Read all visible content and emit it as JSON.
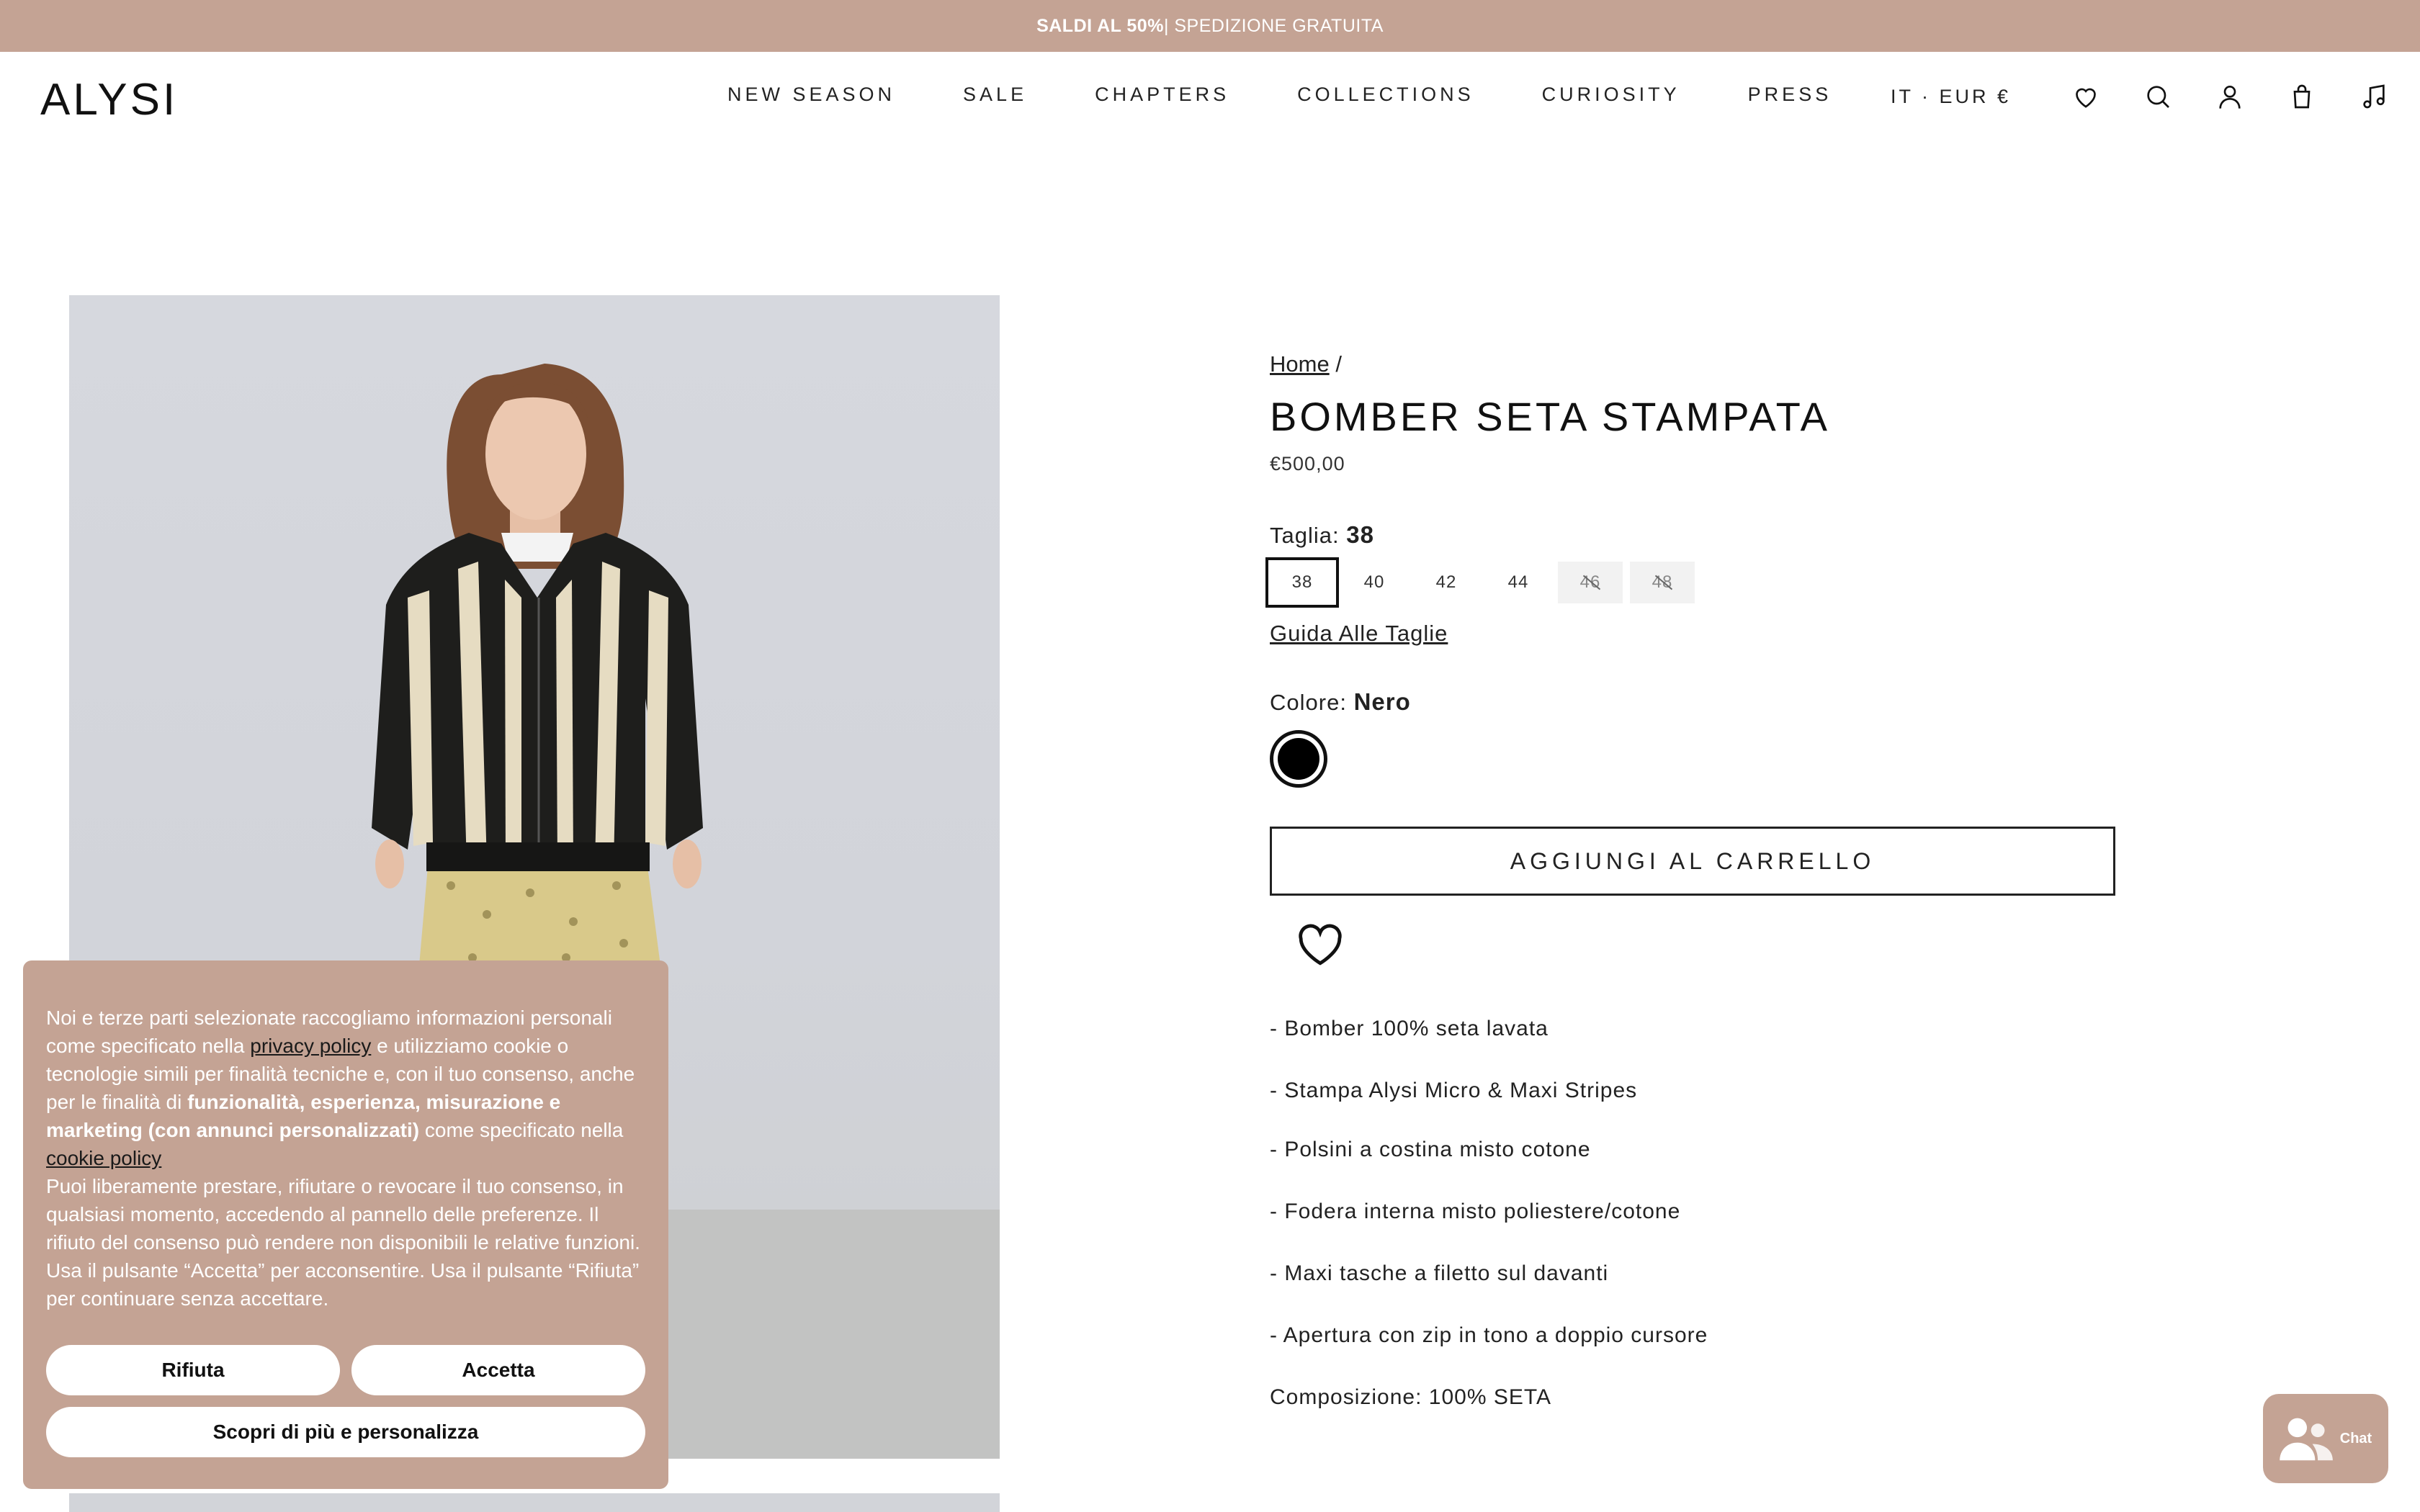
{
  "announcement": {
    "bold": "SALDI AL 50%",
    "rest": "| SPEDIZIONE GRATUITA"
  },
  "header": {
    "logo": "ALYSI",
    "nav": [
      "NEW SEASON",
      "SALE",
      "CHAPTERS",
      "COLLECTIONS",
      "CURIOSITY",
      "PRESS"
    ],
    "locale": "IT · EUR €",
    "icons": [
      "heart-icon",
      "search-icon",
      "user-icon",
      "bag-icon",
      "music-note-icon"
    ]
  },
  "product": {
    "breadcrumb_home": "Home",
    "breadcrumb_sep": "/",
    "title": "BOMBER SETA STAMPATA",
    "price": "€500,00",
    "size_label": "Taglia:",
    "size_selected": "38",
    "sizes": [
      {
        "label": "38",
        "state": "selected"
      },
      {
        "label": "40",
        "state": "available"
      },
      {
        "label": "42",
        "state": "available"
      },
      {
        "label": "44",
        "state": "available"
      },
      {
        "label": "46",
        "state": "disabled"
      },
      {
        "label": "48",
        "state": "disabled"
      }
    ],
    "size_guide": "Guida Alle Taglie",
    "color_label": "Colore:",
    "color_selected": "Nero",
    "color_hex": "#000000",
    "add_to_cart": "AGGIUNGI AL CARRELLO",
    "features": [
      "- Bomber 100% seta lavata",
      "- Stampa Alysi Micro & Maxi Stripes",
      "- Polsini a costina misto cotone",
      "- Fodera interna misto poliestere/cotone",
      "- Maxi tasche a filetto sul davanti",
      "- Apertura con zip in tono a doppio cursore"
    ],
    "composition": "Composizione: 100% SETA"
  },
  "cookie": {
    "t1": "Noi e terze parti selezionate raccogliamo informazioni personali come specificato nella ",
    "privacy_link": "privacy policy",
    "t2": " e utilizziamo cookie o tecnologie simili per finalità tecniche e, con il tuo consenso, anche per le finalità di ",
    "bold": "funzionalità, esperienza, misurazione e marketing (con annunci personalizzati)",
    "t3": " come specificato nella ",
    "cookie_link": "cookie policy",
    "t4": "Puoi liberamente prestare, rifiutare o revocare il tuo consenso, in qualsiasi momento, accedendo al pannello delle preferenze. Il rifiuto del consenso può rendere non disponibili le relative funzioni. Usa il pulsante “Accetta” per acconsentire. Usa il pulsante “Rifiuta” per continuare senza accettare.",
    "reject": "Rifiuta",
    "accept": "Accetta",
    "customize": "Scopri di più e personalizza"
  },
  "chat": {
    "label": "Chat"
  },
  "colors": {
    "brand_pink": "#c4a394",
    "text": "#111111"
  }
}
